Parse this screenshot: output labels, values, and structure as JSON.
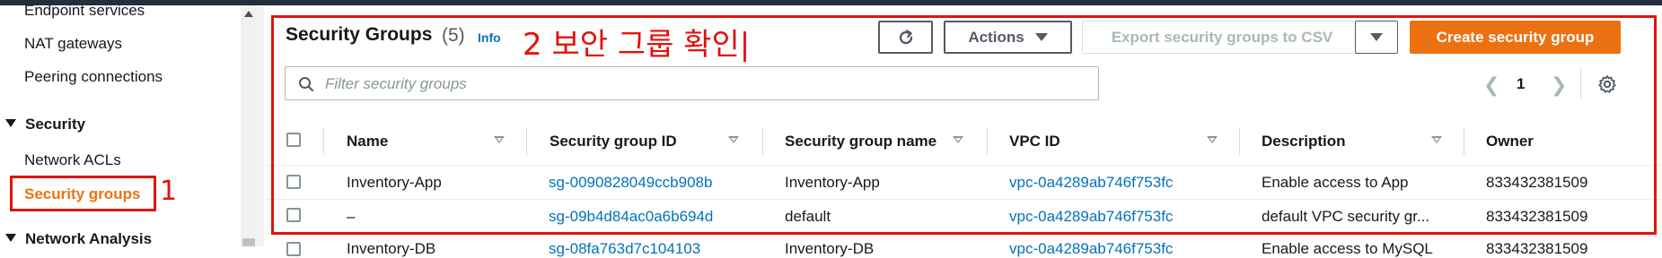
{
  "sidebar": {
    "items_top": [
      "Endpoint services",
      "NAT gateways",
      "Peering connections"
    ],
    "security_section": "Security",
    "security_items": [
      "Network ACLs",
      "Security groups"
    ],
    "network_analysis_section": "Network Analysis"
  },
  "annotations": {
    "step1": "1",
    "step2": "2 보안 그룹 확인|"
  },
  "header": {
    "title": "Security Groups",
    "count": "(5)",
    "info": "Info"
  },
  "toolbar": {
    "refresh_icon": "refresh-icon",
    "actions_label": "Actions",
    "export_label": "Export security groups to CSV",
    "create_label": "Create security group"
  },
  "search": {
    "placeholder": "Filter security groups"
  },
  "pagination": {
    "current_page": "1"
  },
  "table": {
    "columns": [
      "Name",
      "Security group ID",
      "Security group name",
      "VPC ID",
      "Description",
      "Owner"
    ],
    "rows": [
      {
        "name": "Inventory-App",
        "sg_id": "sg-0090828049ccb908b",
        "sg_name": "Inventory-App",
        "vpc_id": "vpc-0a4289ab746f753fc",
        "description": "Enable access to App",
        "owner": "833432381509"
      },
      {
        "name": "–",
        "sg_id": "sg-09b4d84ac0a6b694d",
        "sg_name": "default",
        "vpc_id": "vpc-0a4289ab746f753fc",
        "description": "default VPC security gr...",
        "owner": "833432381509"
      },
      {
        "name": "Inventory-DB",
        "sg_id": "sg-08fa763d7c104103",
        "sg_name": "Inventory-DB",
        "vpc_id": "vpc-0a4289ab746f753fc",
        "description": "Enable access to MySQL",
        "owner": "833432381509"
      }
    ]
  },
  "colors": {
    "accent": "#ec7211",
    "link": "#0073bb",
    "annotation": "#e3120b"
  }
}
